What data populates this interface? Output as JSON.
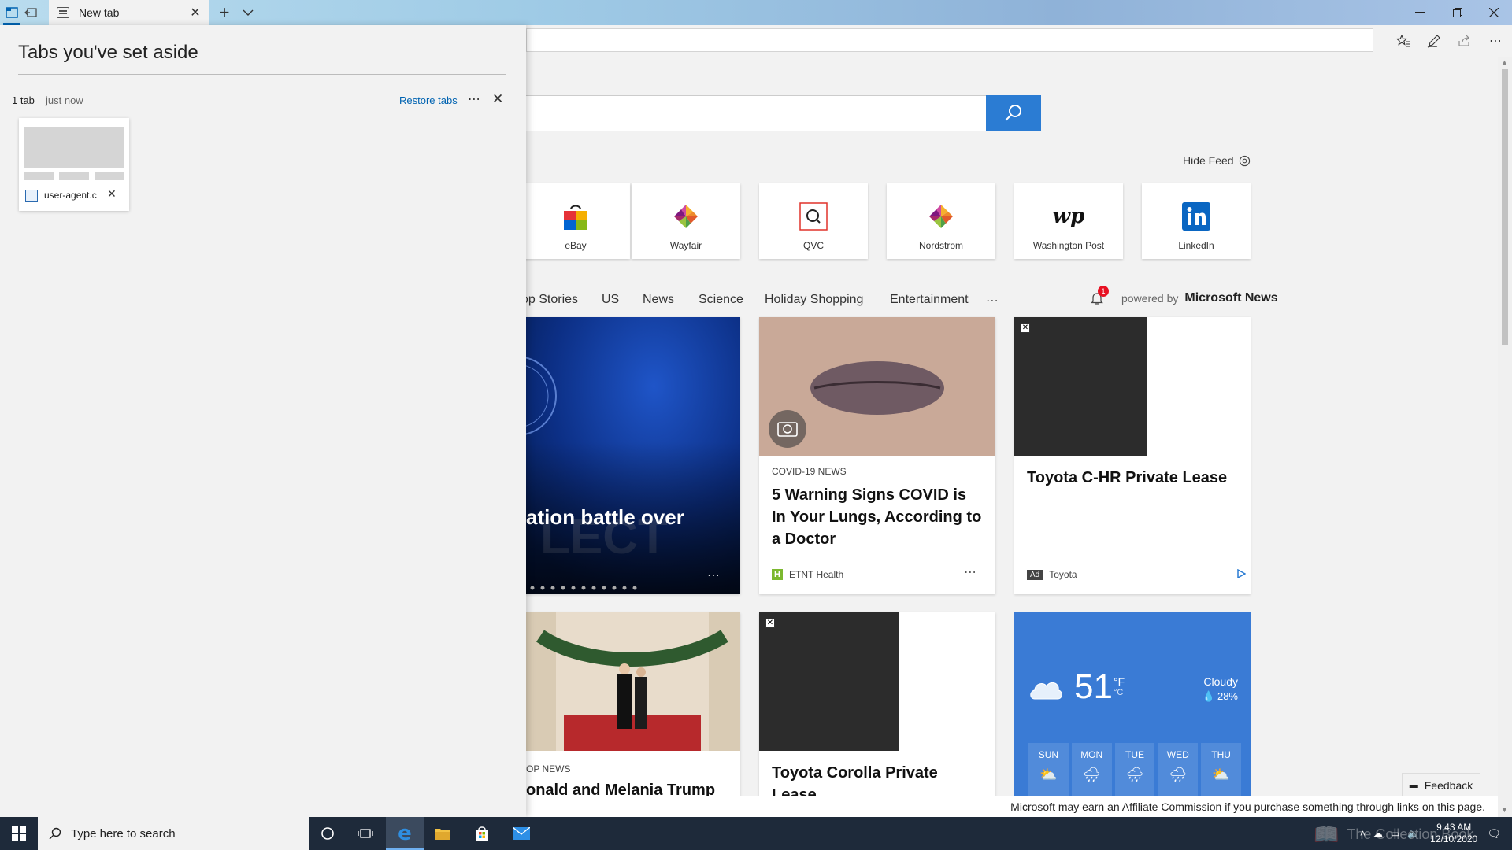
{
  "tab": {
    "title": "New tab"
  },
  "panel": {
    "title": "Tabs you've set aside",
    "set": {
      "count": "1 tab",
      "time": "just now",
      "restore_label": "Restore tabs",
      "thumbnail_title": "user-agent.c"
    }
  },
  "page": {
    "hide_feed_label": "Hide Feed",
    "top_sites": [
      {
        "name": "eBay",
        "icon": "ebay-bag-icon"
      },
      {
        "name": "Wayfair",
        "icon": "wayfair-logo"
      },
      {
        "name": "QVC",
        "icon": "qvc-logo"
      },
      {
        "name": "Nordstrom",
        "icon": "nordstrom-logo"
      },
      {
        "name": "Washington Post",
        "icon": "wapo-logo"
      },
      {
        "name": "LinkedIn",
        "icon": "linkedin-logo"
      }
    ],
    "categories": [
      "op Stories",
      "US",
      "News",
      "Science",
      "Holiday Shopping",
      "Entertainment"
    ],
    "notification_count": "1",
    "powered_prefix": "powered by",
    "powered_brand": "Microsoft News",
    "cards": {
      "hero": {
        "headline": "ation battle over"
      },
      "covid": {
        "kicker": "COVID-19 NEWS",
        "headline": "5 Warning Signs COVID is In Your Lungs, According to a Doctor",
        "source": "ETNT Health"
      },
      "toyota_chr": {
        "headline": "Toyota C-HR Private Lease",
        "ad_label": "Ad",
        "source": "Toyota"
      },
      "trump": {
        "kicker": "OP NEWS",
        "headline": "onald and Melania Trump"
      },
      "toyota_corolla": {
        "headline": "Toyota Corolla Private Lease"
      }
    },
    "weather": {
      "temp": "51",
      "unit_f": "°F",
      "unit_c": "°C",
      "condition": "Cloudy",
      "precip": "28%",
      "days": [
        "SUN",
        "MON",
        "TUE",
        "WED",
        "THU"
      ]
    },
    "feedback_label": "Feedback",
    "affiliate_text": "Microsoft may earn an Affiliate Commission if you purchase something through links on this page."
  },
  "taskbar": {
    "search_placeholder": "Type here to search",
    "time": "9:43 AM",
    "date": "12/10/2020"
  },
  "watermark": "The Collection Book",
  "colors": {
    "accent": "#0063b1",
    "search_button": "#2b7cd3",
    "weather_bg": "#3a7bd5",
    "taskbar": "#1e2a3a"
  }
}
